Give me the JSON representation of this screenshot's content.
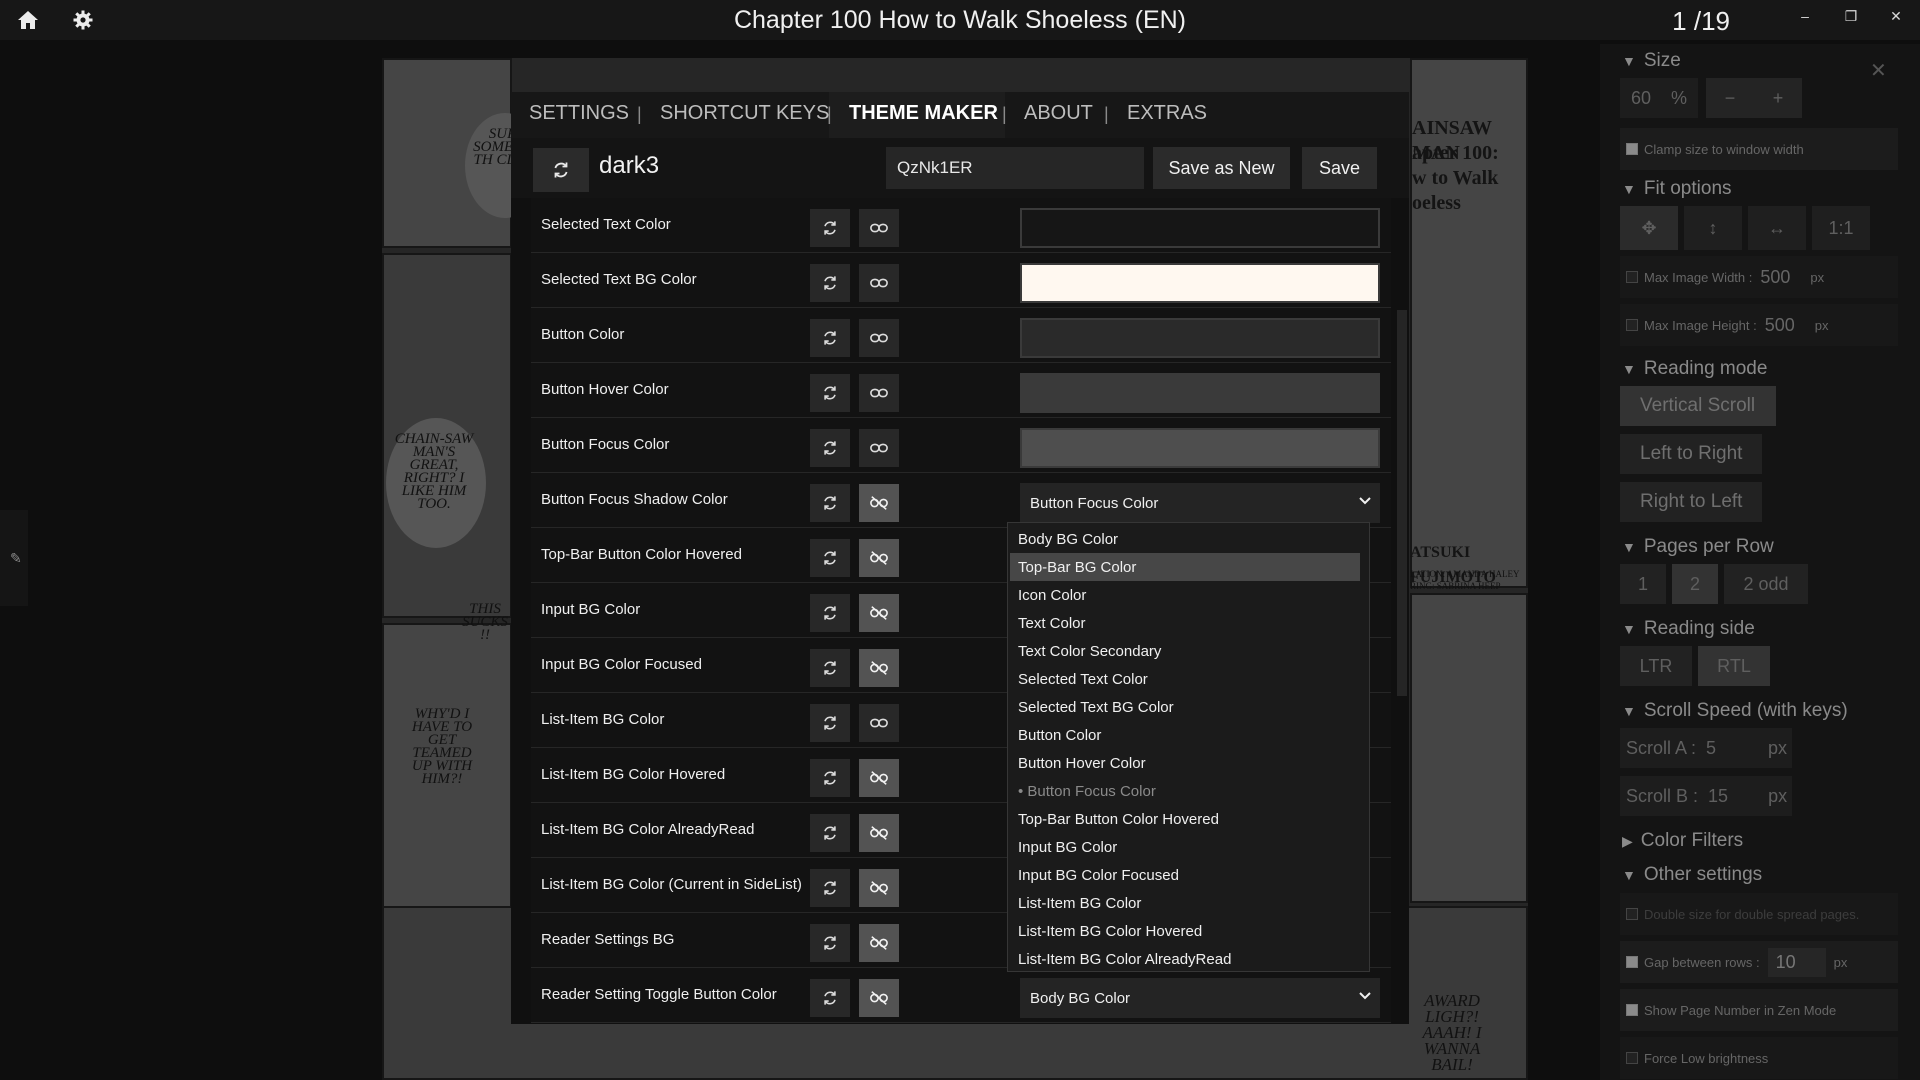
{
  "topbar": {
    "title": "Chapter 100 How to Walk Shoeless (EN)",
    "page_counter": "1 /19",
    "icons": [
      "home-icon",
      "gear-icon"
    ],
    "window_buttons": {
      "minimize": "–",
      "restore": "❐",
      "close": "✕"
    }
  },
  "modal": {
    "tabs": [
      {
        "label": "SETTINGS",
        "active": false
      },
      {
        "label": "SHORTCUT KEYS",
        "active": false
      },
      {
        "label": "THEME MAKER",
        "active": true
      },
      {
        "label": "ABOUT",
        "active": false
      },
      {
        "label": "EXTRAS",
        "active": false
      }
    ],
    "separator": "|",
    "theme_name": "dark3",
    "theme_code": "QzNk1ER",
    "save_as_new_label": "Save as New",
    "save_label": "Save",
    "rows": [
      {
        "label": "Selected Text Color",
        "linked": true,
        "type": "color",
        "color": "#161616"
      },
      {
        "label": "Selected Text BG Color",
        "linked": true,
        "type": "color",
        "color": "#fff8f0"
      },
      {
        "label": "Button Color",
        "linked": true,
        "type": "color",
        "color": "#2a2a2a"
      },
      {
        "label": "Button Hover Color",
        "linked": true,
        "type": "color",
        "color": "#3a3a3a"
      },
      {
        "label": "Button Focus Color",
        "linked": true,
        "type": "color",
        "color": "#4e4e4e"
      },
      {
        "label": "Button Focus Shadow Color",
        "linked": false,
        "type": "select",
        "value": "Button Focus Color"
      },
      {
        "label": "Top-Bar Button Color Hovered",
        "linked": false,
        "type": "none"
      },
      {
        "label": "Input BG Color",
        "linked": false,
        "type": "none"
      },
      {
        "label": "Input BG Color Focused",
        "linked": false,
        "type": "none"
      },
      {
        "label": "List-Item BG Color",
        "linked": true,
        "type": "none"
      },
      {
        "label": "List-Item BG Color Hovered",
        "linked": false,
        "type": "none"
      },
      {
        "label": "List-Item BG Color AlreadyRead",
        "linked": false,
        "type": "none"
      },
      {
        "label": "List-Item BG Color (Current in SideList)",
        "linked": false,
        "type": "none"
      },
      {
        "label": "Reader Settings BG",
        "linked": false,
        "type": "none"
      },
      {
        "label": "Reader Setting Toggle Button Color",
        "linked": false,
        "type": "select",
        "value": "Body BG Color"
      }
    ],
    "dropdown": {
      "highlighted": "Top-Bar BG Color",
      "current": "• Button Focus Color",
      "options": [
        "Body BG Color",
        "Top-Bar BG Color",
        "Icon Color",
        "Text Color",
        "Text Color Secondary",
        "Selected Text Color",
        "Selected Text BG Color",
        "Button Color",
        "Button Hover Color",
        "• Button Focus Color",
        "Top-Bar Button Color Hovered",
        "Input BG Color",
        "Input BG Color Focused",
        "List-Item BG Color",
        "List-Item BG Color Hovered",
        "List-Item BG Color AlreadyRead"
      ]
    }
  },
  "side_panel": {
    "close": "✕",
    "size": {
      "head": "Size",
      "value": "60",
      "unit": "%",
      "minus": "−",
      "plus": "+"
    },
    "clamp": "Clamp size to window width",
    "fit": {
      "head": "Fit options",
      "one_to_one": "1:1"
    },
    "max_width": {
      "label": "Max Image Width :",
      "value": "500",
      "unit": "px"
    },
    "max_height": {
      "label": "Max Image Height :",
      "value": "500",
      "unit": "px"
    },
    "reading_mode": {
      "head": "Reading mode",
      "options": [
        "Vertical Scroll",
        "Left to Right",
        "Right to Left"
      ]
    },
    "pages_per_row": {
      "head": "Pages per Row",
      "options": [
        "1",
        "2",
        "2 odd"
      ]
    },
    "reading_side": {
      "head": "Reading side",
      "options": [
        "LTR",
        "RTL"
      ]
    },
    "scroll_speed": {
      "head": "Scroll Speed (with keys)",
      "a_label": "Scroll A :",
      "a_value": "5",
      "b_label": "Scroll B :",
      "b_value": "15",
      "unit": "px"
    },
    "color_filters": "Color Filters",
    "other": {
      "head": "Other settings",
      "double": "Double size for double spread pages.",
      "gap_label": "Gap between rows :",
      "gap_value": "10",
      "gap_unit": "px",
      "show_page": "Show Page Number in Zen Mode",
      "force_low": "Force Low brightness"
    }
  },
  "manga": {
    "bubble1": "SUP SOME IN TH CLAS",
    "bubble2": "CHAIN-SAW MAN'S GREAT, RIGHT? I LIKE HIM TOO.",
    "bubble3": "THIS SUCKS !!",
    "bubble4": "WHY'D I HAVE TO GET TEAMED UP WITH HIM?!",
    "cover_lines": [
      "AINSAW MAN",
      "apter 100:",
      "w to Walk",
      "oeless"
    ],
    "credit": "ATSUKI FUJIMOTO",
    "credit2": "LATION: AMANDA HALEY",
    "credit3": "RING: SABRINA HEEP",
    "bottom_sfx": "AWARD LIGH?! AAAH! I WANNA BAIL!"
  }
}
